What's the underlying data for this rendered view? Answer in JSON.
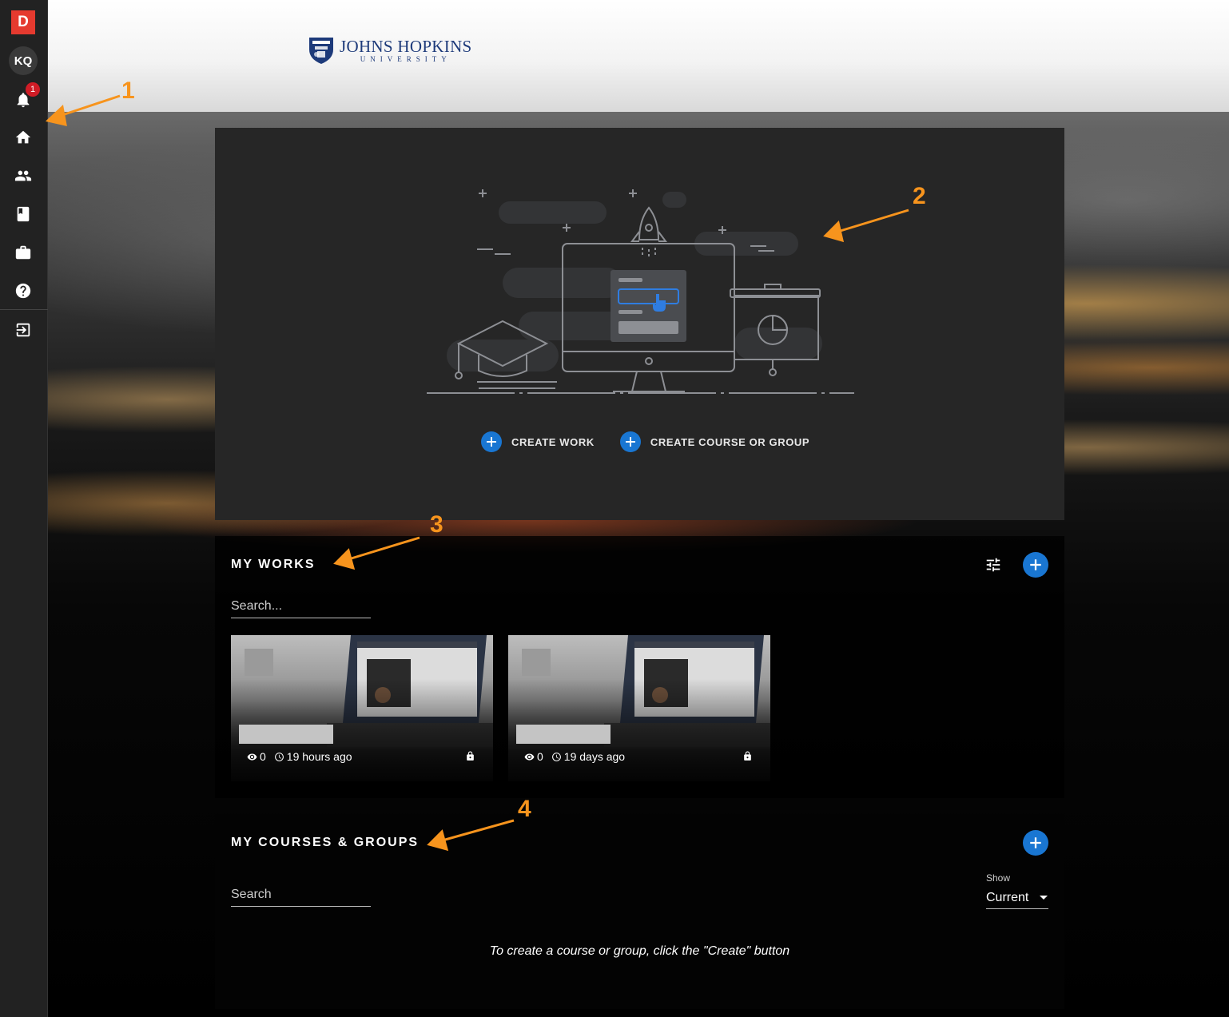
{
  "sidebar": {
    "brand_letter": "D",
    "avatar_initials": "KQ",
    "notification_count": "1",
    "items": [
      {
        "name": "notifications",
        "icon": "bell-icon"
      },
      {
        "name": "home",
        "icon": "home-icon"
      },
      {
        "name": "people",
        "icon": "people-icon"
      },
      {
        "name": "library",
        "icon": "book-icon"
      },
      {
        "name": "portfolio",
        "icon": "briefcase-icon"
      },
      {
        "name": "help",
        "icon": "help-icon"
      },
      {
        "name": "logout",
        "icon": "sign-out-icon"
      }
    ],
    "colors": {
      "brand": "#e53a2f",
      "badge": "#d01c26"
    }
  },
  "header": {
    "logo_name": "JOHNS HOPKINS",
    "logo_sub": "UNIVERSITY"
  },
  "hero": {
    "create_work_label": "CREATE WORK",
    "create_course_label": "CREATE COURSE OR GROUP"
  },
  "works": {
    "title": "MY WORKS",
    "search_placeholder": "Search...",
    "cards": [
      {
        "views": "0",
        "time": "19 hours ago",
        "locked": true
      },
      {
        "views": "0",
        "time": "19 days ago",
        "locked": true
      }
    ]
  },
  "courses": {
    "title": "MY COURSES & GROUPS",
    "search_placeholder": "Search",
    "show_label": "Show",
    "show_value": "Current",
    "empty_message": "To create a course or group, click the \"Create\" button"
  },
  "annotations": [
    "1",
    "2",
    "3",
    "4"
  ],
  "accent_color": "#1976d2",
  "annotation_color": "#f7941d"
}
